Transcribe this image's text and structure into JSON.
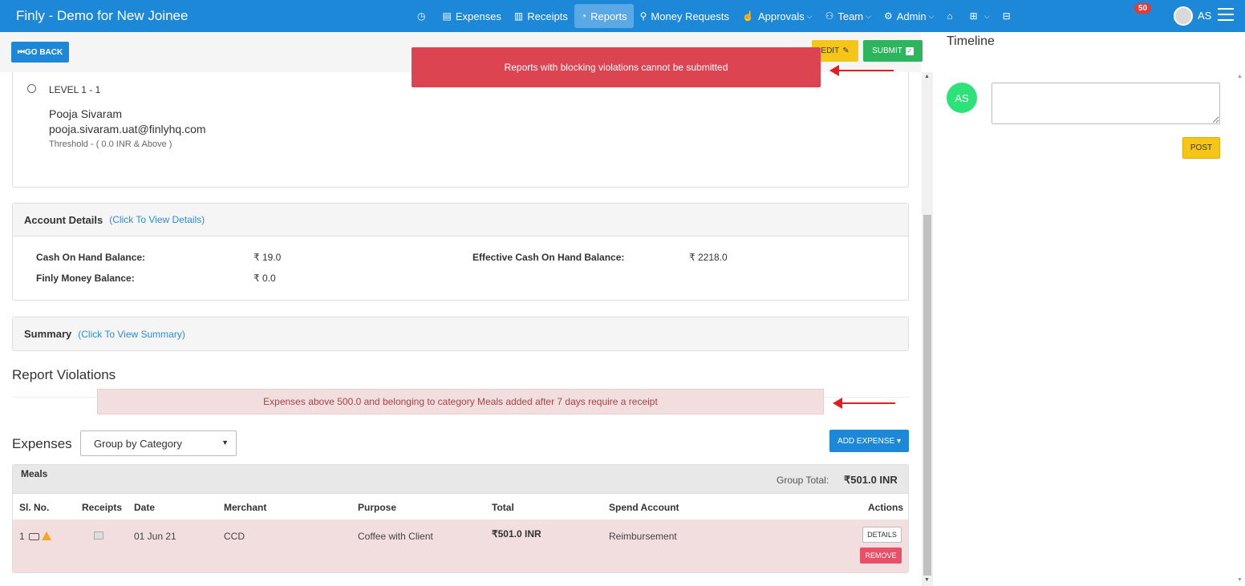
{
  "app": {
    "title": "Finly - Demo for New Joinee"
  },
  "nav": {
    "items": [
      {
        "label": "",
        "icon": "dashboard-icon"
      },
      {
        "label": "Expenses",
        "icon": "expenses-icon"
      },
      {
        "label": "Receipts",
        "icon": "receipts-icon"
      },
      {
        "label": "Reports",
        "icon": "reports-icon",
        "active": true
      },
      {
        "label": "Money Requests",
        "icon": "money-requests-icon"
      },
      {
        "label": "Approvals",
        "icon": "approvals-icon",
        "dropdown": true
      },
      {
        "label": "Team",
        "icon": "team-icon",
        "dropdown": true
      },
      {
        "label": "Admin",
        "icon": "admin-icon",
        "dropdown": true
      },
      {
        "label": "",
        "icon": "bank-icon"
      },
      {
        "label": "",
        "icon": "add-icon",
        "dropdown": true
      },
      {
        "label": "",
        "icon": "inbox-icon"
      }
    ],
    "notification_count": "50",
    "user_initials": "AS"
  },
  "toolbar": {
    "go_back_label": "GO BACK",
    "edit_label": "EDIT",
    "submit_label": "SUBMIT"
  },
  "error_toast": {
    "message": "Reports with blocking violations cannot be submitted"
  },
  "approver": {
    "level": "LEVEL 1 -  1",
    "name": "Pooja Sivaram",
    "email": "pooja.sivaram.uat@finlyhq.com",
    "threshold": "Threshold -  ( 0.0 INR & Above )"
  },
  "account_details": {
    "title": "Account Details",
    "link": "(Click To View Details)",
    "cash_on_hand_label": "Cash On Hand Balance:",
    "cash_on_hand_value": "₹  19.0",
    "effective_cash_label": "Effective Cash On Hand Balance:",
    "effective_cash_value": "₹  2218.0",
    "finly_money_label": "Finly Money Balance:",
    "finly_money_value": "₹  0.0"
  },
  "summary": {
    "title": "Summary",
    "link": "(Click To View Summary)"
  },
  "violations": {
    "title": "Report Violations",
    "message": "Expenses above 500.0 and belonging to category Meals added after 7 days require a receipt"
  },
  "expenses": {
    "title": "Expenses",
    "group_by_selected": "Group by Category",
    "add_expense_label": "ADD EXPENSE ▾",
    "group": {
      "name": "Meals",
      "total_label": "Group Total:",
      "total_value": "₹501.0 INR"
    },
    "columns": [
      "Sl. No.",
      "Receipts",
      "Date",
      "Merchant",
      "Purpose",
      "Total",
      "Spend Account",
      "Actions"
    ],
    "rows": [
      {
        "sl_no": "1",
        "date": "01 Jun 21",
        "merchant": "CCD",
        "purpose": "Coffee with Client",
        "total": "₹501.0 INR",
        "spend_account": "Reimbursement",
        "details_label": "DETAILS",
        "remove_label": "REMOVE"
      }
    ]
  },
  "timeline": {
    "title": "Timeline",
    "avatar_initials": "AS",
    "post_label": "POST"
  },
  "colors": {
    "primary": "#1e88d8",
    "error": "#dc4451",
    "success": "#2db55d",
    "warning": "#f5c518",
    "violation_bg": "#f2dede"
  }
}
